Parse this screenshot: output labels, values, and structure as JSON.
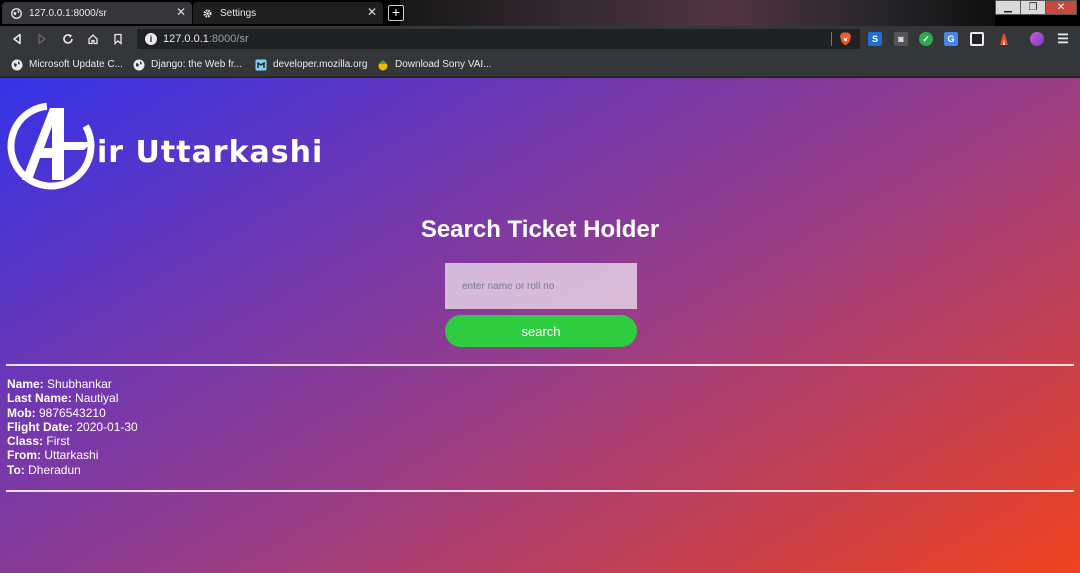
{
  "browser": {
    "tabs": [
      {
        "title": "127.0.0.1:8000/sr",
        "active": true
      },
      {
        "title": "Settings",
        "active": false
      }
    ],
    "new_tab_label": "+",
    "url": {
      "host": "127.0.0.1",
      "path": ":8000/sr"
    },
    "bookmarks": [
      {
        "label": "Microsoft Update C...",
        "icon": "globe-icon"
      },
      {
        "label": "Django: the Web fr...",
        "icon": "globe-icon"
      },
      {
        "label": "developer.mozilla.org",
        "icon": "mozilla-icon"
      },
      {
        "label": "Download Sony VAI...",
        "icon": "folder-icon"
      }
    ],
    "extensions": [
      "s-extension-icon",
      "ghost-extension-icon",
      "check-extension-icon",
      "translate-extension-icon",
      "square-extension-icon",
      "rewards-extension-icon",
      "profile-icon",
      "menu-icon"
    ]
  },
  "site": {
    "brand": "ir Uttarkashi",
    "page_title": "Search Ticket Holder",
    "search": {
      "placeholder": "enter name or roll no",
      "value": "",
      "button_label": "search"
    },
    "ticket": [
      {
        "key": "Name:",
        "value": "Shubhankar"
      },
      {
        "key": "Last Name:",
        "value": "Nautiyal"
      },
      {
        "key": "Mob:",
        "value": "9876543210"
      },
      {
        "key": "Flight Date:",
        "value": "2020-01-30"
      },
      {
        "key": "Class:",
        "value": "First"
      },
      {
        "key": "From:",
        "value": "Uttarkashi"
      },
      {
        "key": "To:",
        "value": "Dheradun"
      }
    ]
  },
  "colors": {
    "gradient_start": "#3433e8",
    "gradient_end": "#f1421e",
    "search_button": "#2ecc40"
  }
}
